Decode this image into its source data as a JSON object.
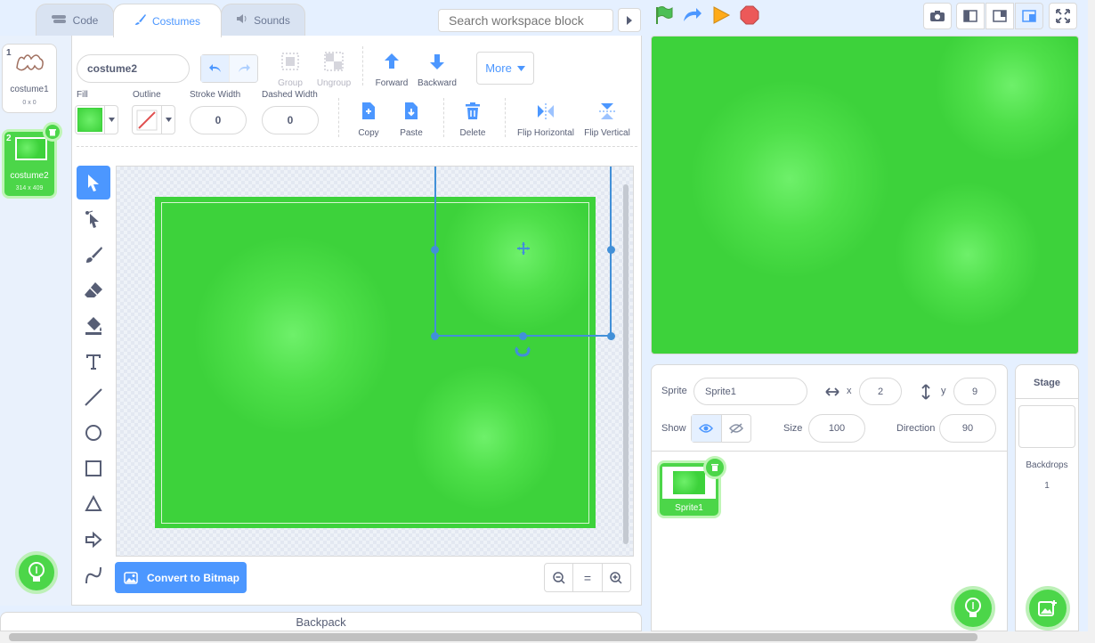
{
  "tabs": [
    {
      "label": "Code",
      "icon": "code-icon"
    },
    {
      "label": "Costumes",
      "icon": "paintbrush-icon"
    },
    {
      "label": "Sounds",
      "icon": "speaker-icon"
    }
  ],
  "search": {
    "placeholder": "Search workspace block"
  },
  "costumes": [
    {
      "index": "1",
      "name": "costume1",
      "size": "0 x 0"
    },
    {
      "index": "2",
      "name": "costume2",
      "size": "314 x 409"
    }
  ],
  "editor": {
    "costume_name": "costume2",
    "toolbar": {
      "group": "Group",
      "ungroup": "Ungroup",
      "forward": "Forward",
      "backward": "Backward",
      "more": "More",
      "copy": "Copy",
      "paste": "Paste",
      "delete": "Delete",
      "flip_h": "Flip Horizontal",
      "flip_v": "Flip Vertical"
    },
    "fill_label": "Fill",
    "outline_label": "Outline",
    "stroke_width_label": "Stroke Width",
    "stroke_width": "0",
    "dashed_width_label": "Dashed Width",
    "dashed_width": "0",
    "convert_button": "Convert to Bitmap",
    "zoom_reset": "=",
    "fill_color": "#4cd649"
  },
  "backpack": {
    "label": "Backpack"
  },
  "sprite_info": {
    "sprite_label": "Sprite",
    "sprite_name": "Sprite1",
    "x_label": "x",
    "x": "2",
    "y_label": "y",
    "y": "9",
    "show_label": "Show",
    "size_label": "Size",
    "size": "100",
    "direction_label": "Direction",
    "direction": "90"
  },
  "sprites": [
    {
      "name": "Sprite1"
    }
  ],
  "stage_panel": {
    "title": "Stage",
    "backdrops_label": "Backdrops",
    "backdrops_count": "1"
  },
  "colors": {
    "accent": "#4c97ff",
    "green": "#3dd23b",
    "selected": "#4cd649"
  }
}
